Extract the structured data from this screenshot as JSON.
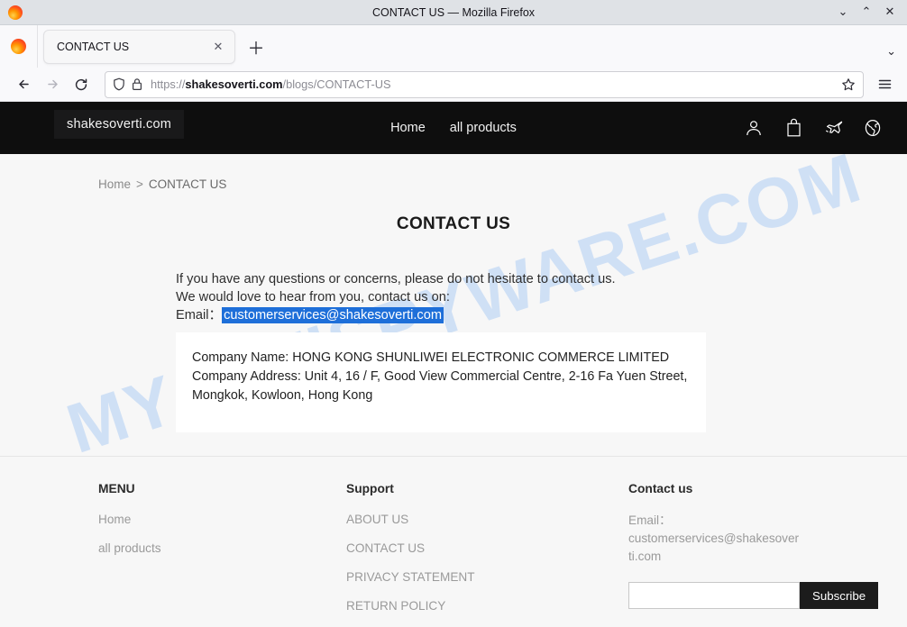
{
  "browser": {
    "window_title": "CONTACT US — Mozilla Firefox",
    "window_controls": {
      "minimize": "⌄",
      "maximize": "⌃",
      "close": "✕"
    },
    "tab": {
      "title": "CONTACT US",
      "close_label": "✕"
    },
    "new_tab_label": "＋",
    "tab_list_chevron": "⌄",
    "url": {
      "scheme": "https://",
      "host": "shakesoverti.com",
      "path": "/blogs/CONTACT-US"
    }
  },
  "site": {
    "logo": "shakesoverti.com",
    "nav": [
      {
        "label": "Home"
      },
      {
        "label": "all products"
      }
    ],
    "header_icons": [
      {
        "name": "account-icon"
      },
      {
        "name": "shopping-bag-icon"
      },
      {
        "name": "airplane-icon"
      },
      {
        "name": "globe-icon"
      }
    ]
  },
  "page": {
    "watermark": "MYANTISPYWARE.COM",
    "breadcrumb": {
      "home": "Home",
      "separator": ">",
      "current": "CONTACT US"
    },
    "title": "CONTACT US",
    "intro_line1": "If you have any questions or concerns, please do not hesitate to contact us.",
    "intro_line2": "We would love to hear from you, contact us on:",
    "email_label": "Email：",
    "email_value": "customerservices@shakesoverti.com",
    "company_name": "Company Name: HONG KONG SHUNLIWEI ELECTRONIC COMMERCE LIMITED",
    "company_address": "Company Address: Unit 4, 16 / F, Good View Commercial Centre, 2-16 Fa Yuen Street, Mongkok, Kowloon, Hong Kong"
  },
  "footer": {
    "menu": {
      "heading": "MENU",
      "items": [
        {
          "label": "Home"
        },
        {
          "label": "all products"
        }
      ]
    },
    "support": {
      "heading": "Support",
      "items": [
        {
          "label": "ABOUT US"
        },
        {
          "label": "CONTACT US"
        },
        {
          "label": "PRIVACY STATEMENT"
        },
        {
          "label": "RETURN POLICY"
        }
      ]
    },
    "contact": {
      "heading": "Contact us",
      "email_text": "Email：customerservices@shakesoverti.com",
      "input_value": "",
      "input_placeholder": "",
      "subscribe_label": "Subscribe"
    }
  },
  "colors": {
    "site_header_bg": "#0e0e0e",
    "selection_blue": "#1e6fd9",
    "watermark_blue": "#c9dcf5",
    "footer_bg": "#f7f7f7"
  }
}
